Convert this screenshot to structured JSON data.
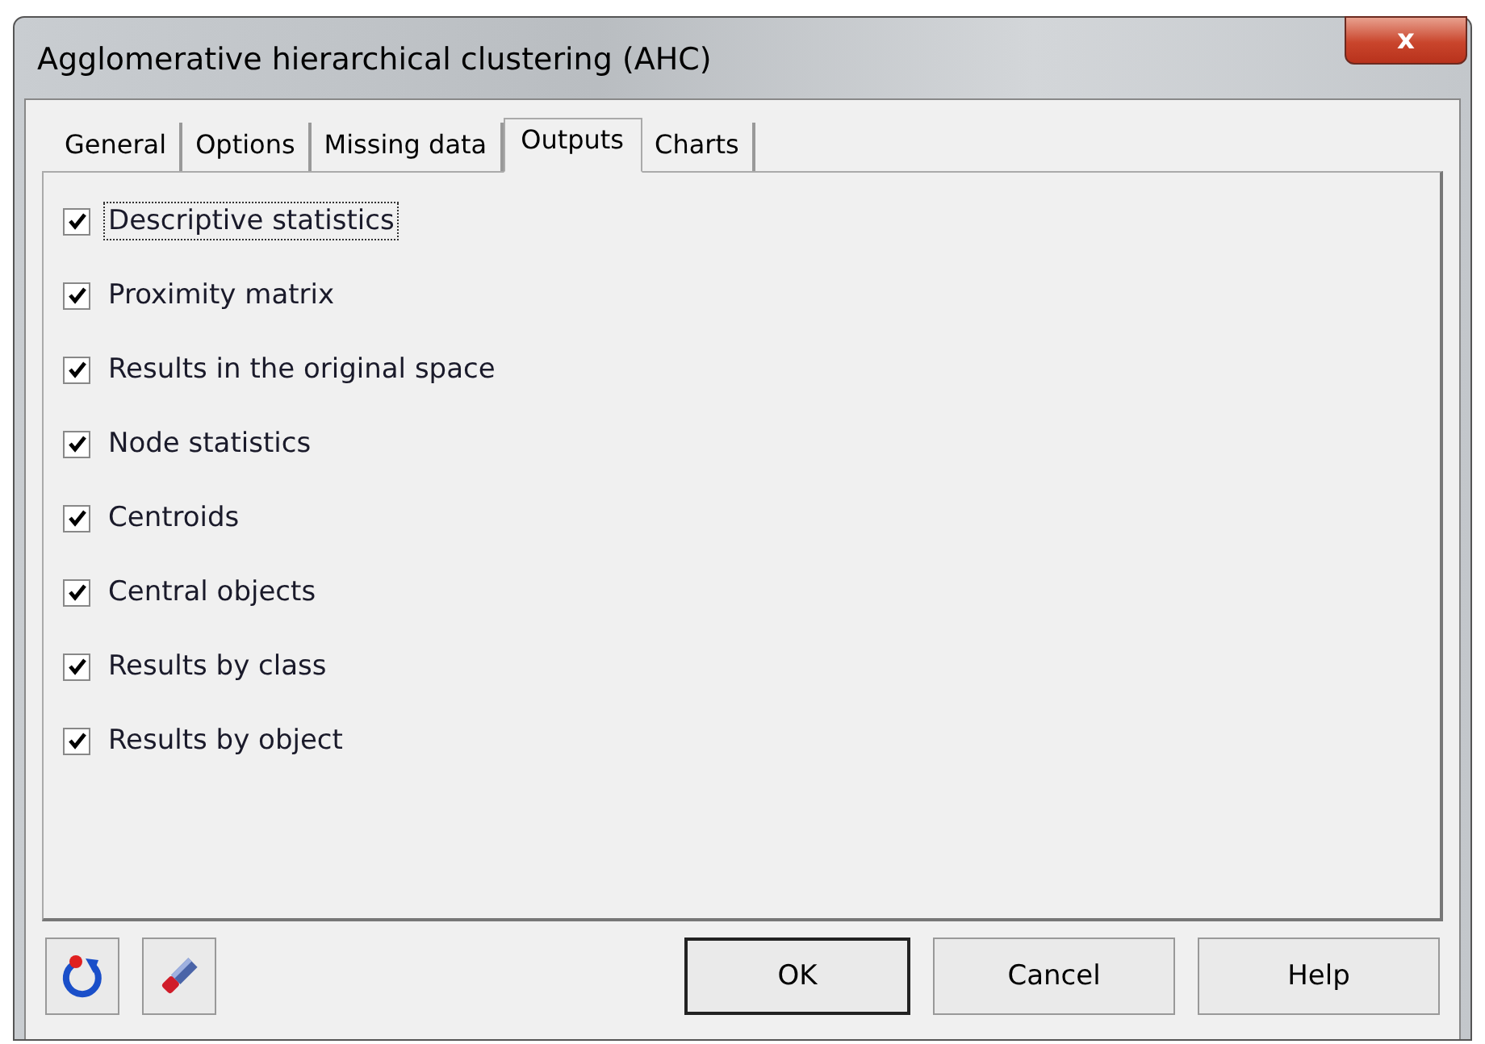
{
  "window": {
    "title": "Agglomerative hierarchical clustering (AHC)",
    "close_label": "x"
  },
  "tabs": [
    {
      "label": "General",
      "selected": false
    },
    {
      "label": "Options",
      "selected": false
    },
    {
      "label": "Missing data",
      "selected": false
    },
    {
      "label": "Outputs",
      "selected": true
    },
    {
      "label": "Charts",
      "selected": false
    }
  ],
  "options": [
    {
      "label": "Descriptive statistics",
      "checked": true,
      "focused": true
    },
    {
      "label": "Proximity matrix",
      "checked": true,
      "focused": false
    },
    {
      "label": "Results in the original space",
      "checked": true,
      "focused": false
    },
    {
      "label": "Node statistics",
      "checked": true,
      "focused": false
    },
    {
      "label": "Centroids",
      "checked": true,
      "focused": false
    },
    {
      "label": "Central objects",
      "checked": true,
      "focused": false
    },
    {
      "label": "Results by class",
      "checked": true,
      "focused": false
    },
    {
      "label": "Results by object",
      "checked": true,
      "focused": false
    }
  ],
  "buttons": [
    {
      "label": "OK",
      "default": true
    },
    {
      "label": "Cancel",
      "default": false
    },
    {
      "label": "Help",
      "default": false
    }
  ]
}
